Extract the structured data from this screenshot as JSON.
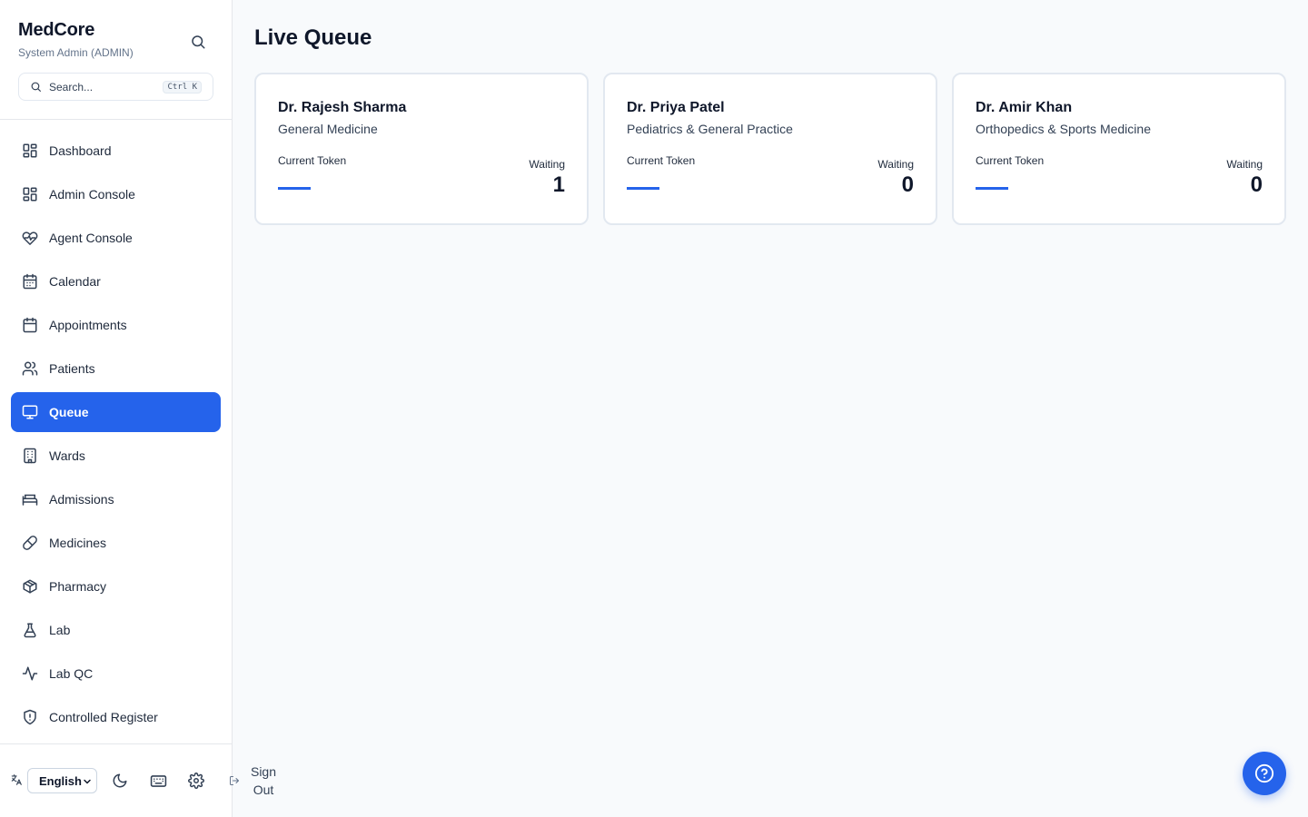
{
  "app": {
    "name": "MedCore",
    "user": "System Admin (ADMIN)"
  },
  "search": {
    "placeholder": "Search...",
    "shortcut": "Ctrl K"
  },
  "nav": {
    "items": [
      {
        "label": "Dashboard",
        "icon": "grid-icon",
        "active": false
      },
      {
        "label": "Admin Console",
        "icon": "grid-icon",
        "active": false
      },
      {
        "label": "Agent Console",
        "icon": "heart-pulse-icon",
        "active": false
      },
      {
        "label": "Calendar",
        "icon": "calendar-days-icon",
        "active": false
      },
      {
        "label": "Appointments",
        "icon": "calendar-icon",
        "active": false
      },
      {
        "label": "Patients",
        "icon": "users-icon",
        "active": false
      },
      {
        "label": "Queue",
        "icon": "monitor-icon",
        "active": true
      },
      {
        "label": "Wards",
        "icon": "building-icon",
        "active": false
      },
      {
        "label": "Admissions",
        "icon": "bed-icon",
        "active": false
      },
      {
        "label": "Medicines",
        "icon": "pill-icon",
        "active": false
      },
      {
        "label": "Pharmacy",
        "icon": "package-icon",
        "active": false
      },
      {
        "label": "Lab",
        "icon": "flask-icon",
        "active": false
      },
      {
        "label": "Lab QC",
        "icon": "activity-icon",
        "active": false
      },
      {
        "label": "Controlled Register",
        "icon": "shield-icon",
        "active": false
      }
    ]
  },
  "footer": {
    "language": "English",
    "sign_out": "Sign Out"
  },
  "main": {
    "title": "Live Queue",
    "token_label": "Current Token",
    "waiting_label": "Waiting",
    "doctors": [
      {
        "name": "Dr. Rajesh Sharma",
        "department": "General Medicine",
        "current_token": "—",
        "waiting": "1"
      },
      {
        "name": "Dr. Priya Patel",
        "department": "Pediatrics & General Practice",
        "current_token": "—",
        "waiting": "0"
      },
      {
        "name": "Dr. Amir Khan",
        "department": "Orthopedics & Sports Medicine",
        "current_token": "—",
        "waiting": "0"
      }
    ]
  },
  "colors": {
    "accent": "#2563eb",
    "text": "#0f172a",
    "muted": "#64748b",
    "background": "#f8fafc"
  }
}
